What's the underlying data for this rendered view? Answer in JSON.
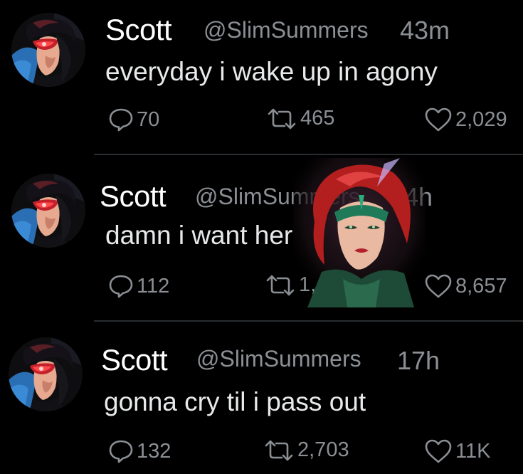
{
  "tweets": [
    {
      "name": "Scott",
      "handle": "@SlimSummers",
      "time": "43m",
      "text": "everyday i wake up in agony",
      "replies": "70",
      "retweets": "465",
      "likes": "2,029"
    },
    {
      "name": "Scott",
      "handle": "@SlimSummers",
      "time": "14h",
      "text": "damn i want her",
      "replies": "112",
      "retweets": "1,450",
      "likes": "8,657"
    },
    {
      "name": "Scott",
      "handle": "@SlimSummers",
      "time": "17h",
      "text": "gonna cry til i pass out",
      "replies": "132",
      "retweets": "2,703",
      "likes": "11K"
    }
  ],
  "icons": {
    "reply": "speech-bubble-icon",
    "retweet": "retweet-arrows-icon",
    "like": "heart-icon"
  },
  "colors": {
    "background": "#000000",
    "name": "#ffffff",
    "muted": "#8b8f94",
    "text": "#e7e9ea"
  }
}
